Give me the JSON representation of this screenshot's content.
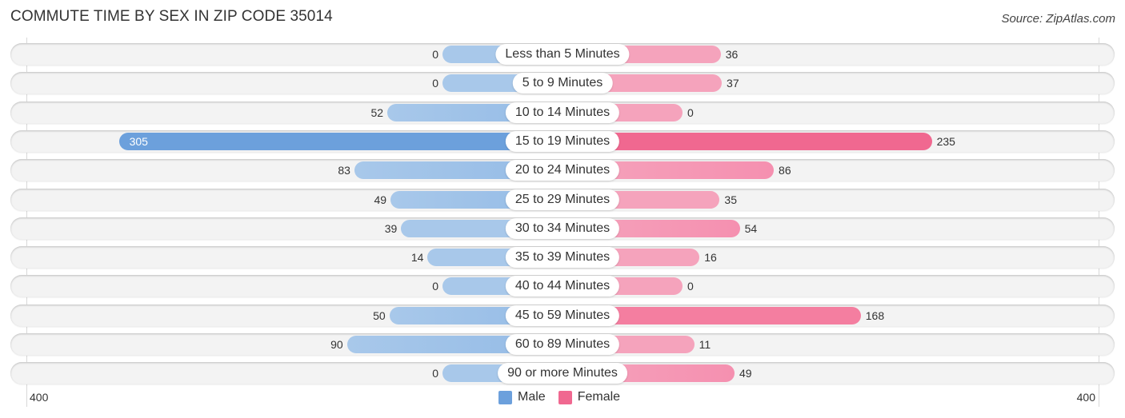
{
  "title": "COMMUTE TIME BY SEX IN ZIP CODE 35014",
  "source": "Source: ZipAtlas.com",
  "colors": {
    "male": "#6ca0dc",
    "male_light": "#a8c8ea",
    "female": "#f06890",
    "female_light": "#f5a3bc"
  },
  "chart_data": {
    "type": "bar",
    "orientation": "horizontal-diverging",
    "title": "COMMUTE TIME BY SEX IN ZIP CODE 35014",
    "categories": [
      "Less than 5 Minutes",
      "5 to 9 Minutes",
      "10 to 14 Minutes",
      "15 to 19 Minutes",
      "20 to 24 Minutes",
      "25 to 29 Minutes",
      "30 to 34 Minutes",
      "35 to 39 Minutes",
      "40 to 44 Minutes",
      "45 to 59 Minutes",
      "60 to 89 Minutes",
      "90 or more Minutes"
    ],
    "series": [
      {
        "name": "Male",
        "values": [
          0,
          0,
          52,
          305,
          83,
          49,
          39,
          14,
          0,
          50,
          90,
          0
        ]
      },
      {
        "name": "Female",
        "values": [
          36,
          37,
          0,
          235,
          86,
          35,
          54,
          16,
          0,
          168,
          11,
          49
        ]
      }
    ],
    "xlim": [
      -400,
      400
    ],
    "axis_tick_labels": {
      "left": "400",
      "right": "400"
    },
    "legend": {
      "position": "bottom-center",
      "entries": [
        "Male",
        "Female"
      ]
    },
    "grid": false
  }
}
